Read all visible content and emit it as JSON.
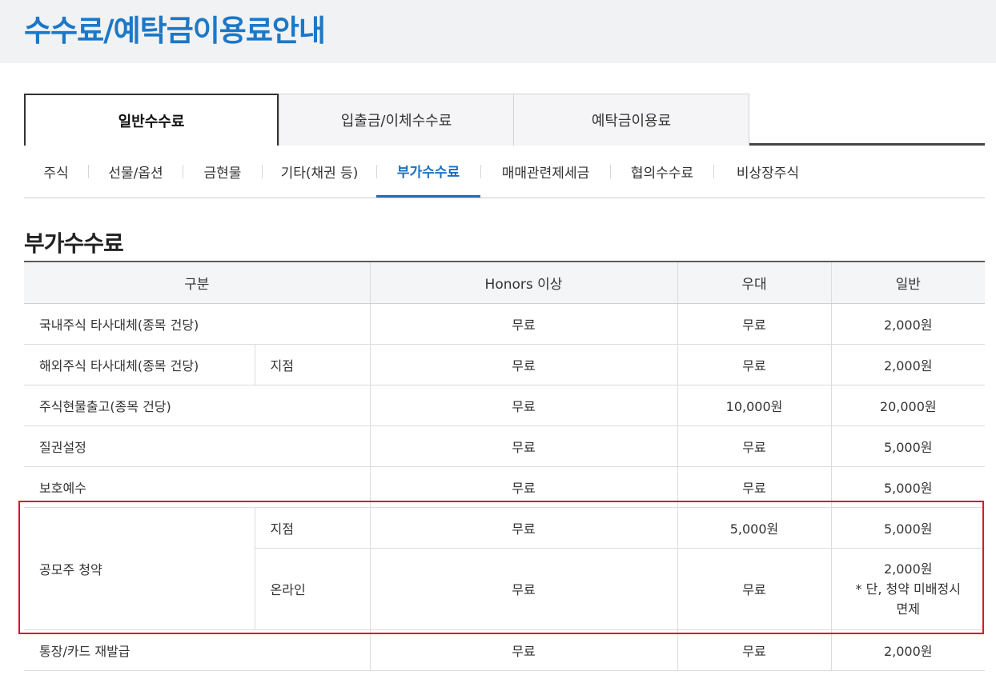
{
  "page": {
    "title": "수수료/예탁금이용료안내"
  },
  "main_tabs": [
    {
      "label": "일반수수료",
      "active": true
    },
    {
      "label": "입출금/이체수수료",
      "active": false
    },
    {
      "label": "예탁금이용료",
      "active": false
    }
  ],
  "sub_tabs": [
    {
      "label": "주식",
      "active": false
    },
    {
      "label": "선물/옵션",
      "active": false
    },
    {
      "label": "금현물",
      "active": false
    },
    {
      "label": "기타(채권 등)",
      "active": false
    },
    {
      "label": "부가수수료",
      "active": true
    },
    {
      "label": "매매관련제세금",
      "active": false
    },
    {
      "label": "협의수수료",
      "active": false
    },
    {
      "label": "비상장주식",
      "active": false
    }
  ],
  "section": {
    "title": "부가수수료"
  },
  "table": {
    "headers": [
      "구분",
      "Honors 이상",
      "우대",
      "일반"
    ],
    "rows": [
      {
        "category": "국내주식 타사대체(종목 건당)",
        "sub": "",
        "honors": "무료",
        "preferred": "무료",
        "general": "2,000원"
      },
      {
        "category": "해외주식 타사대체(종목 건당)",
        "sub": "지점",
        "honors": "무료",
        "preferred": "무료",
        "general": "2,000원"
      },
      {
        "category": "주식현물출고(종목 건당)",
        "sub": "",
        "honors": "무료",
        "preferred": "10,000원",
        "general": "20,000원"
      },
      {
        "category": "질권설정",
        "sub": "",
        "honors": "무료",
        "preferred": "무료",
        "general": "5,000원"
      },
      {
        "category": "보호예수",
        "sub": "",
        "honors": "무료",
        "preferred": "무료",
        "general": "5,000원"
      }
    ],
    "ipo": {
      "category": "공모주 청약",
      "branch": {
        "sub": "지점",
        "honors": "무료",
        "preferred": "5,000원",
        "general": "5,000원"
      },
      "online": {
        "sub": "온라인",
        "honors": "무료",
        "preferred": "무료",
        "general_line1": "2,000원",
        "general_line2": "* 단, 청약 미배정시",
        "general_line3": "면제"
      }
    },
    "last_row": {
      "category": "통장/카드 재발급",
      "honors": "무료",
      "preferred": "무료",
      "general": "2,000원"
    }
  },
  "colors": {
    "title_blue": "#1c78c7",
    "active_sub_tab": "#1c6fc0",
    "highlight_red": "#d21f1f",
    "header_bg": "#f1f2f4"
  }
}
